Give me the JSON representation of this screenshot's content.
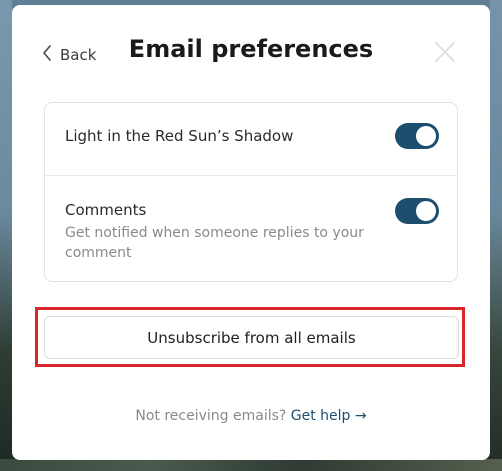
{
  "modal": {
    "back_label": "Back",
    "title": "Email preferences"
  },
  "preferences": [
    {
      "title": "Light in the Red Sun’s Shadow",
      "description": "",
      "enabled": true
    },
    {
      "title": "Comments",
      "description": "Get notified when someone replies to your comment",
      "enabled": true
    }
  ],
  "unsubscribe_label": "Unsubscribe from all emails",
  "footer": {
    "text": "Not receiving emails?",
    "link": "Get help →"
  },
  "colors": {
    "toggle_on": "#1d4e6e",
    "link": "#1d4e6e",
    "highlight": "#d9262a"
  },
  "icons": {
    "back": "chevron-left-icon",
    "close": "close-icon"
  }
}
